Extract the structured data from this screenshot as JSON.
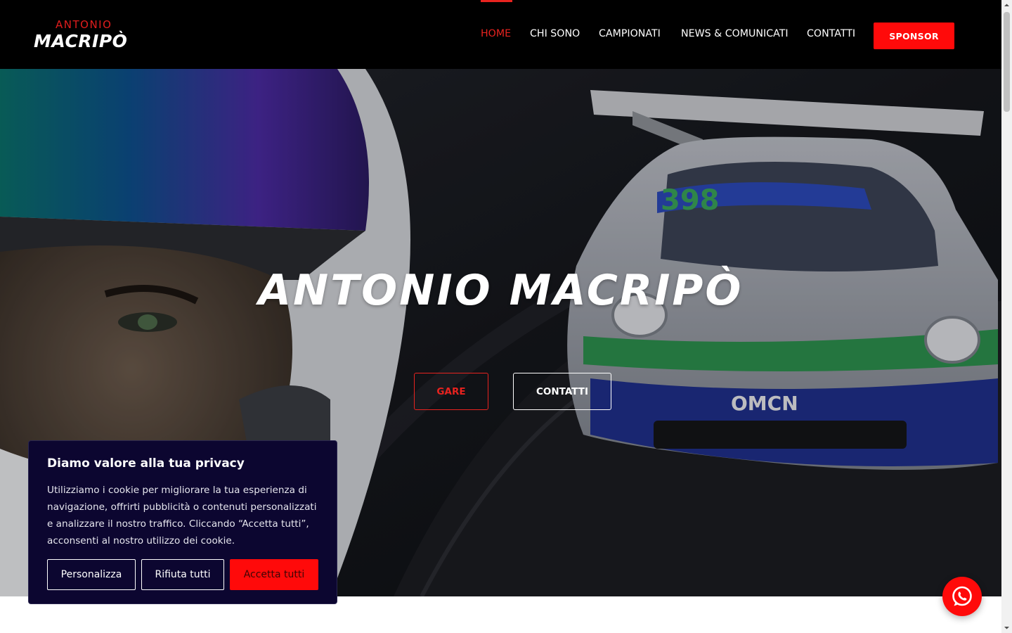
{
  "logo": {
    "top": "ANTONIO",
    "main": "MACRIPÒ"
  },
  "nav": {
    "items": [
      {
        "label": "HOME",
        "active": true
      },
      {
        "label": "CHI SONO",
        "active": false
      },
      {
        "label": "CAMPIONATI",
        "active": false
      },
      {
        "label": "NEWS & COMUNICATI",
        "active": false
      },
      {
        "label": "CONTATTI",
        "active": false
      }
    ],
    "sponsor": "SPONSOR"
  },
  "hero": {
    "title": "ANTONIO MACRIPÒ",
    "btn_gare": "GARE",
    "btn_contatti": "CONTATTI"
  },
  "cookie": {
    "title": "Diamo valore alla tua privacy",
    "text": "Utilizziamo i cookie per migliorare la tua esperienza di navigazione, offrirti pubblicità o contenuti personalizzati e analizzare il nostro traffico. Cliccando “Accetta tutti”, acconsenti al nostro utilizzo dei cookie.",
    "btn_customize": "Personalizza",
    "btn_reject": "Rifiuta tutti",
    "btn_accept": "Accetta tutti"
  },
  "colors": {
    "accent": "#ff0a0a",
    "nav_active": "#e8231f",
    "header_bg": "#000000",
    "cookie_bg": "#0c0630"
  },
  "icons": {
    "whatsapp": "whatsapp-icon"
  }
}
